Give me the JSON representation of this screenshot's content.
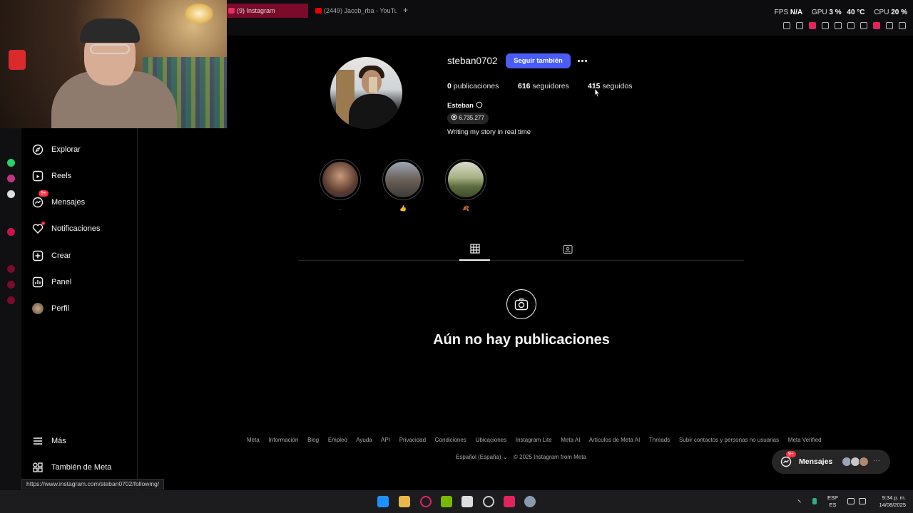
{
  "browser": {
    "tabs": [
      {
        "label": "(9) Instagram"
      },
      {
        "label": "(2449) Jacob_rba - YouTu"
      }
    ],
    "new_tab": "+",
    "stats": {
      "fps_label": "FPS",
      "fps_value": "N/A",
      "gpu_label": "GPU",
      "gpu_value": "3 %",
      "gpu_temp": "40 °C",
      "cpu_label": "CPU",
      "cpu_value": "20 %"
    }
  },
  "sidebar": {
    "items": [
      {
        "label": "Explorar",
        "icon": "compass-icon"
      },
      {
        "label": "Reels",
        "icon": "reels-icon"
      },
      {
        "label": "Mensajes",
        "icon": "messenger-icon",
        "badge": "9+"
      },
      {
        "label": "Notificaciones",
        "icon": "heart-icon"
      },
      {
        "label": "Crear",
        "icon": "plus-square-icon"
      },
      {
        "label": "Panel",
        "icon": "bar-chart-icon"
      },
      {
        "label": "Perfil",
        "icon": "avatar"
      },
      {
        "label": "Más",
        "icon": "menu-icon"
      },
      {
        "label": "También de Meta",
        "icon": "meta-apps-icon"
      }
    ]
  },
  "profile": {
    "username": "steban0702",
    "follow_label": "Seguir también",
    "posts_count": "0",
    "posts_label": "publicaciones",
    "followers_count": "616",
    "followers_label": "seguidores",
    "following_count": "415",
    "following_label": "seguidos",
    "full_name": "Esteban",
    "threads_count": "6.735.277",
    "bio": "Writing my story in real time",
    "highlights": [
      {
        "label": "."
      },
      {
        "label": "👍"
      },
      {
        "label": "🍂"
      }
    ],
    "empty_title": "Aún no hay publicaciones"
  },
  "footer": {
    "links": [
      "Meta",
      "Información",
      "Blog",
      "Empleo",
      "Ayuda",
      "API",
      "Privacidad",
      "Condiciones",
      "Ubicaciones",
      "Instagram Lite",
      "Meta AI",
      "Artículos de Meta AI",
      "Threads",
      "Subir contactos y personas no usuarias",
      "Meta Verified"
    ],
    "language": "Español (España)",
    "copyright": "© 2025 Instagram from Meta"
  },
  "messages_pill": {
    "label": "Mensajes",
    "badge": "9+"
  },
  "status_url": "https://www.instagram.com/steban0702/following/",
  "taskbar": {
    "lang_top": "ESP",
    "lang_bottom": "ES",
    "time": "9:34 p. m.",
    "date": "14/08/2025"
  },
  "colors": {
    "accent": "#4a5df9",
    "badge": "#ff3040",
    "tab_active": "#7a0b2a"
  }
}
